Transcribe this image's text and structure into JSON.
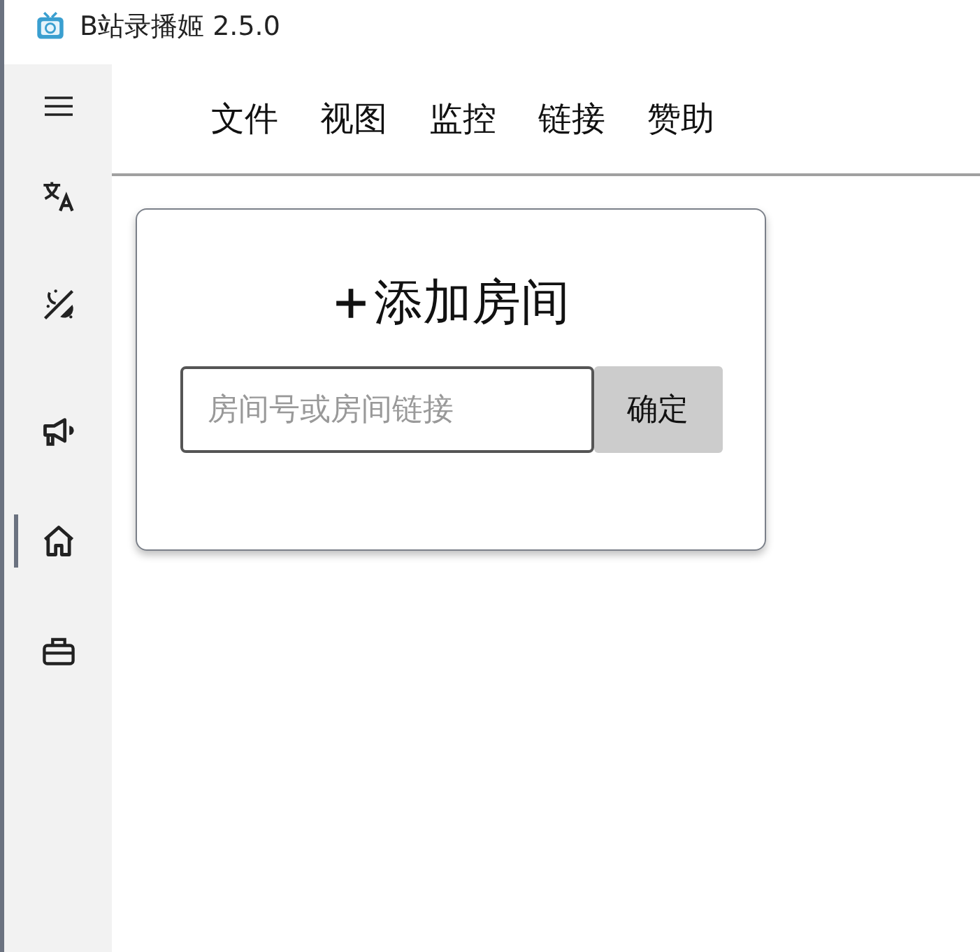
{
  "window": {
    "title": "B站录播姬 2.5.0"
  },
  "sidebar": {
    "items": [
      {
        "kind": "language",
        "selected": false
      },
      {
        "kind": "theme",
        "selected": false
      },
      {
        "kind": "announcement",
        "selected": false
      },
      {
        "kind": "home",
        "selected": true
      },
      {
        "kind": "toolbox",
        "selected": false
      }
    ]
  },
  "menu": [
    "文件",
    "视图",
    "监控",
    "链接",
    "赞助"
  ],
  "add_room": {
    "title": "添加房间",
    "input": {
      "placeholder": "房间号或房间链接"
    },
    "button": "确定"
  }
}
